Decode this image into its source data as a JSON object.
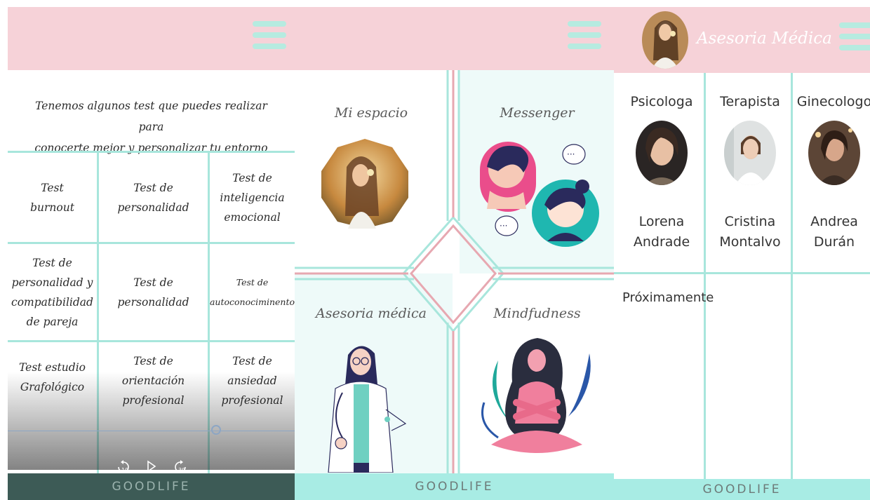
{
  "brand": "GOODLIFE",
  "colors": {
    "header_pink": "#f6d2d8",
    "mint": "#a8e6dc",
    "footer_mint": "#a8ece4",
    "dark_footer": "#3d5b56"
  },
  "tests_screen": {
    "intro_line1": "Tenemos algunos test que puedes realizar para",
    "intro_line2": "conocerte mejor y personalizar tu entorno",
    "tests": [
      {
        "line1": "Test",
        "line2": "burnout"
      },
      {
        "line1": "Test de",
        "line2": "personalidad"
      },
      {
        "line1": "Test de",
        "line2": "inteligencia",
        "line3": "emocional"
      },
      {
        "line1": "Test de",
        "line2": "personalidad y",
        "line3": "compatibilidad",
        "line4": "de pareja"
      },
      {
        "line1": "Test de",
        "line2": "personalidad"
      },
      {
        "line1": "Test de",
        "line2": "autoconociminento"
      },
      {
        "line1": "Test estudio",
        "line2": "Grafológico"
      },
      {
        "line1": "Test de",
        "line2": "orientación",
        "line3": "profesional"
      },
      {
        "line1": "Test de",
        "line2": "ansiedad",
        "line3": "profesional"
      }
    ],
    "player": {
      "rewind_label": "10",
      "forward_label": "30",
      "rewind_icon": "rewind-10-icon",
      "play_icon": "play-icon",
      "forward_icon": "forward-30-icon"
    }
  },
  "home_screen": {
    "sections": [
      "Mi espacio",
      "Messenger",
      "Asesoria médica",
      "Mindfudness"
    ]
  },
  "medical_screen": {
    "title": "Asesoria Médica",
    "specialists": [
      {
        "role": "Psicologa",
        "first": "Lorena",
        "last": "Andrade"
      },
      {
        "role": "Terapista",
        "first": "Cristina",
        "last": "Montalvo"
      },
      {
        "role": "Ginecologo",
        "first": "Andrea",
        "last": "Durán"
      }
    ],
    "coming_soon": "Próximamente"
  }
}
